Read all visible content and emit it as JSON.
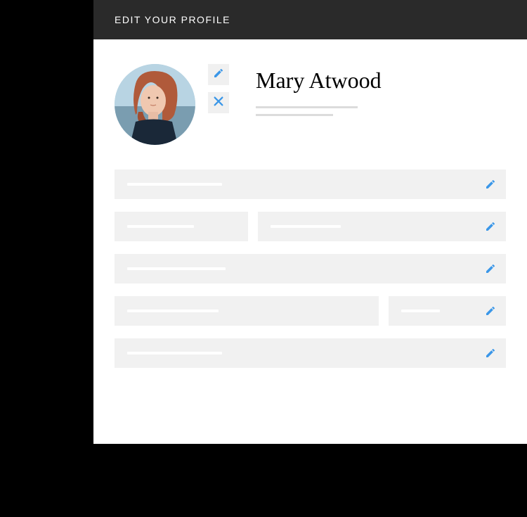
{
  "header": {
    "title": "EDIT YOUR PROFILE"
  },
  "profile": {
    "name": "Mary Atwood"
  },
  "icons": {
    "pencil": "pencil-icon",
    "close": "close-icon"
  },
  "colors": {
    "accent": "#3b97e8",
    "headerBg": "#2a2a2a",
    "fieldBg": "#f1f1f1",
    "placeholderBar": "#ffffff"
  }
}
